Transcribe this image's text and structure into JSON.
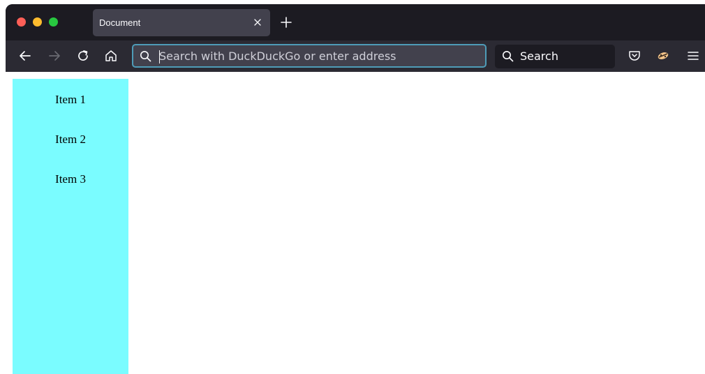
{
  "browser": {
    "tab": {
      "title": "Document",
      "close_icon": "close-icon"
    },
    "new_tab_icon": "plus-icon",
    "toolbar": {
      "back_icon": "arrow-left-icon",
      "forward_icon": "arrow-right-icon",
      "reload_icon": "reload-icon",
      "home_icon": "home-icon",
      "address_placeholder": "Search with DuckDuckGo or enter address",
      "address_value": "",
      "search_label": "Search",
      "pocket_icon": "pocket-icon",
      "extension_icon": "extension-icon",
      "menu_icon": "hamburger-menu-icon"
    },
    "colors": {
      "frame": "#1c1b22",
      "toolbar": "#2b2a33",
      "tab_active": "#42414d",
      "urlbar_focus": "#4e9cb8"
    }
  },
  "page": {
    "sidebar": {
      "background": "#7afcff",
      "items": [
        {
          "label": "Item 1"
        },
        {
          "label": "Item 2"
        },
        {
          "label": "Item 3"
        }
      ]
    }
  }
}
